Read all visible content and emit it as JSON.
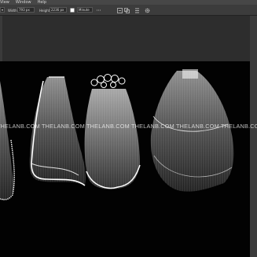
{
  "menu": {
    "items": [
      "View",
      "Window",
      "Help"
    ]
  },
  "options_bar": {
    "width_label": "Width:",
    "width_value": "793 px",
    "height_label": "Height:",
    "height_value": "2236 px",
    "stroke_value": "Minute",
    "icons": [
      "align-icon",
      "path-ops-icon",
      "arrange-icon",
      "gear-icon"
    ]
  },
  "canvas": {
    "watermark": "THELANB.COM  THELANB.COM  THELANB.COM  THELANB.COM  THELANB.COM  THELANB.COM"
  },
  "colors": {
    "canvas_bg": "#020202",
    "chrome": "#3c3c3c",
    "veil": "#f2f2f2"
  }
}
